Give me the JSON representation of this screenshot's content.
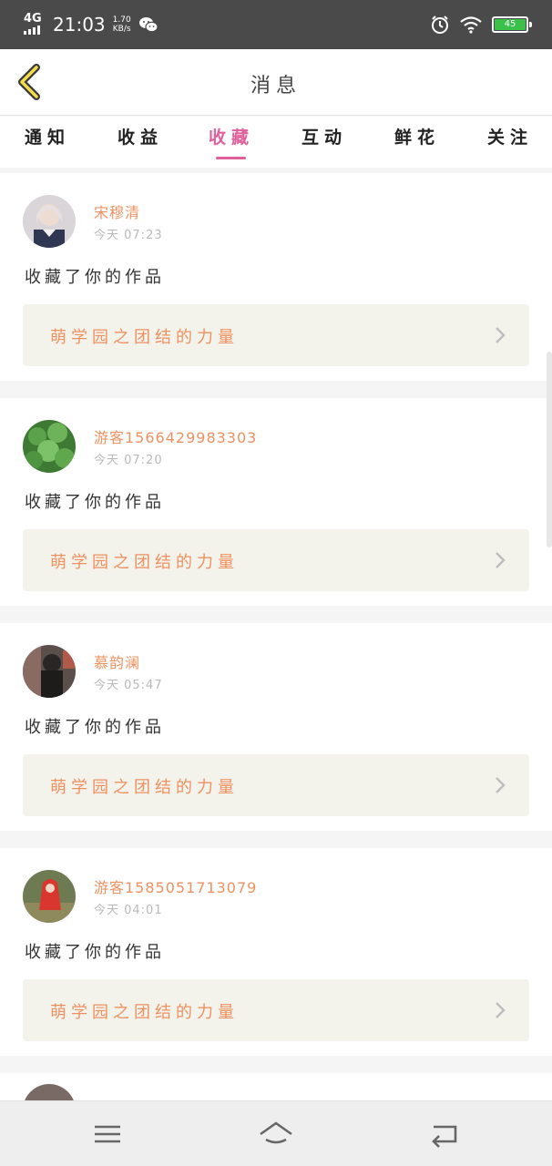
{
  "status_bar": {
    "network": "4G",
    "time": "21:03",
    "speed_value": "1.70",
    "speed_unit": "KB/s",
    "battery": "45",
    "icons": [
      "signal-icon",
      "wechat-icon",
      "alarm-icon",
      "wifi-icon",
      "battery-icon"
    ]
  },
  "header": {
    "back_icon": "chevron-left-icon",
    "title": "消息"
  },
  "tabs": [
    {
      "label": "通知",
      "active": false
    },
    {
      "label": "收益",
      "active": false
    },
    {
      "label": "收藏",
      "active": true
    },
    {
      "label": "互动",
      "active": false
    },
    {
      "label": "鲜花",
      "active": false
    },
    {
      "label": "关注",
      "active": false
    }
  ],
  "messages": [
    {
      "user": "宋穆清",
      "time": "今天 07:23",
      "action": "收藏了你的作品",
      "work_title": "萌学园之团结的力量"
    },
    {
      "user": "游客1566429983303",
      "time": "今天 07:20",
      "action": "收藏了你的作品",
      "work_title": "萌学园之团结的力量"
    },
    {
      "user": "慕韵澜",
      "time": "今天 05:47",
      "action": "收藏了你的作品",
      "work_title": "萌学园之团结的力量"
    },
    {
      "user": "游客1585051713079",
      "time": "今天 04:01",
      "action": "收藏了你的作品",
      "work_title": "萌学园之团结的力量"
    }
  ],
  "colors": {
    "accent": "#e0609b",
    "username": "#ee9161",
    "work_bg": "#f3f3ec",
    "statusbar_bg": "#4a4a4a",
    "battery": "#39c14a"
  },
  "nav_bar": {
    "icons": [
      "menu-icon",
      "home-icon",
      "back-icon"
    ]
  }
}
